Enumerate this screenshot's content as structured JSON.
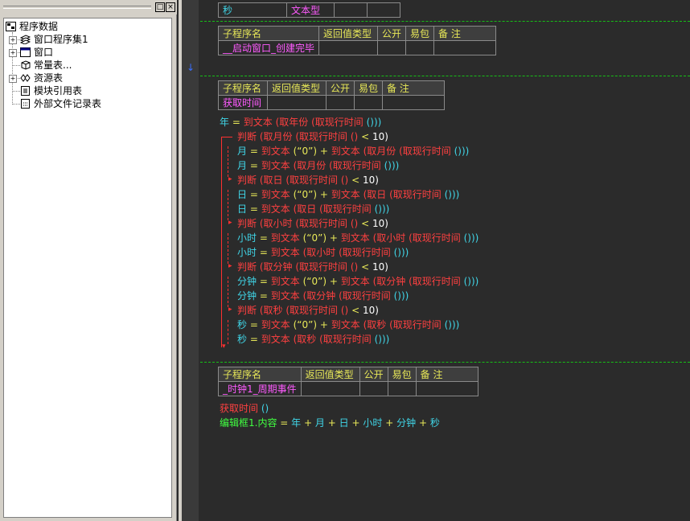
{
  "titlebar": {
    "pin": "□",
    "close": "×"
  },
  "tree": {
    "root": "程序数据",
    "items": [
      {
        "label": "窗口程序集1",
        "expander": "+"
      },
      {
        "label": "窗口",
        "expander": "+"
      },
      {
        "label": "常量表...",
        "expander": ""
      },
      {
        "label": "资源表",
        "expander": "+"
      },
      {
        "label": "模块引用表",
        "expander": ""
      },
      {
        "label": "外部文件记录表",
        "expander": ""
      }
    ]
  },
  "top_table": {
    "name": "秒",
    "type": "文本型"
  },
  "sub_headers": {
    "name": "子程序名",
    "ret": "返回值类型",
    "pub": "公开",
    "easy": "易包",
    "note": "备 注"
  },
  "subs": [
    {
      "name": "__启动窗口_创建完毕"
    },
    {
      "name": "获取时间"
    },
    {
      "name": "_时钟1_周期事件"
    }
  ],
  "code": {
    "l1": [
      "年",
      "=",
      "到文本",
      "(取年份",
      "(取现行时间",
      "()))"
    ],
    "l2": [
      "判断",
      "(取月份",
      "(取现行时间",
      "()",
      "<",
      "10)"
    ],
    "l3": [
      "月",
      "=",
      "到文本",
      "(“0”)",
      "+",
      "到文本",
      "(取月份",
      "(取现行时间",
      "()))"
    ],
    "l4": [
      "月",
      "=",
      "到文本",
      "(取月份",
      "(取现行时间",
      "()))"
    ],
    "l5": [
      "判断",
      "(取日",
      "(取现行时间",
      "()",
      "<",
      "10)"
    ],
    "l6": [
      "日",
      "=",
      "到文本",
      "(“0”)",
      "+",
      "到文本",
      "(取日",
      "(取现行时间",
      "()))"
    ],
    "l7": [
      "日",
      "=",
      "到文本",
      "(取日",
      "(取现行时间",
      "()))"
    ],
    "l8": [
      "判断",
      "(取小时",
      "(取现行时间",
      "()",
      "<",
      "10)"
    ],
    "l9": [
      "小时",
      "=",
      "到文本",
      "(“0”)",
      "+",
      "到文本",
      "(取小时",
      "(取现行时间",
      "()))"
    ],
    "l10": [
      "小时",
      "=",
      "到文本",
      "(取小时",
      "(取现行时间",
      "()))"
    ],
    "l11": [
      "判断",
      "(取分钟",
      "(取现行时间",
      "()",
      "<",
      "10)"
    ],
    "l12": [
      "分钟",
      "=",
      "到文本",
      "(“0”)",
      "+",
      "到文本",
      "(取分钟",
      "(取现行时间",
      "()))"
    ],
    "l13": [
      "分钟",
      "=",
      "到文本",
      "(取分钟",
      "(取现行时间",
      "()))"
    ],
    "l14": [
      "判断",
      "(取秒",
      "(取现行时间",
      "()",
      "<",
      "10)"
    ],
    "l15": [
      "秒",
      "=",
      "到文本",
      "(“0”)",
      "+",
      "到文本",
      "(取秒",
      "(取现行时间",
      "()))"
    ],
    "l16": [
      "秒",
      "=",
      "到文本",
      "(取秒",
      "(取现行时间",
      "()))"
    ],
    "t1": [
      "获取时间",
      "()"
    ],
    "t2": [
      "编辑框1.内容",
      "=",
      "年",
      "+",
      "月",
      "+",
      "日",
      "+",
      "小时",
      "+",
      "分钟",
      "+",
      "秒"
    ]
  }
}
